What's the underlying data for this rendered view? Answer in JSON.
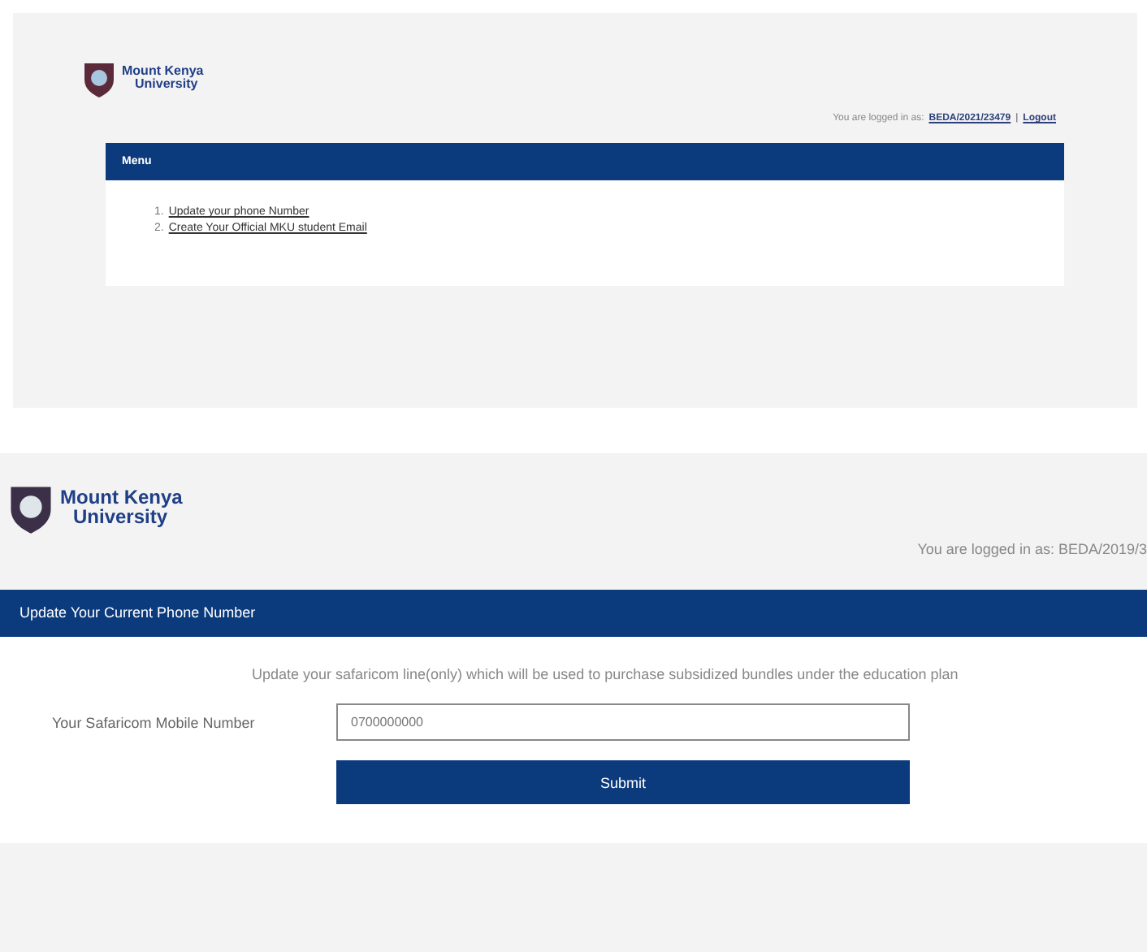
{
  "menu_page": {
    "logo": {
      "line1": "Mount Kenya",
      "line2": "University"
    },
    "login": {
      "prefix": "You are logged in as:",
      "user": "BEDA/2021/23479",
      "separator": "|",
      "logout": "Logout"
    },
    "menu": {
      "title": "Menu",
      "items": [
        {
          "number": "1.",
          "label": "Update your phone Number"
        },
        {
          "number": "2.",
          "label": "Create Your Official MKU student Email"
        }
      ]
    }
  },
  "phone_page": {
    "logo": {
      "line1": "Mount Kenya",
      "line2": "University"
    },
    "login": {
      "prefix": "You are logged in as:",
      "user": "BEDA/2019/3"
    },
    "panel": {
      "title": "Update Your Current Phone Number",
      "description": "Update your safaricom line(only) which will be used to purchase subsidized bundles under the education plan",
      "field_label": "Your Safaricom Mobile Number",
      "placeholder": "0700000000",
      "submit": "Submit"
    }
  }
}
